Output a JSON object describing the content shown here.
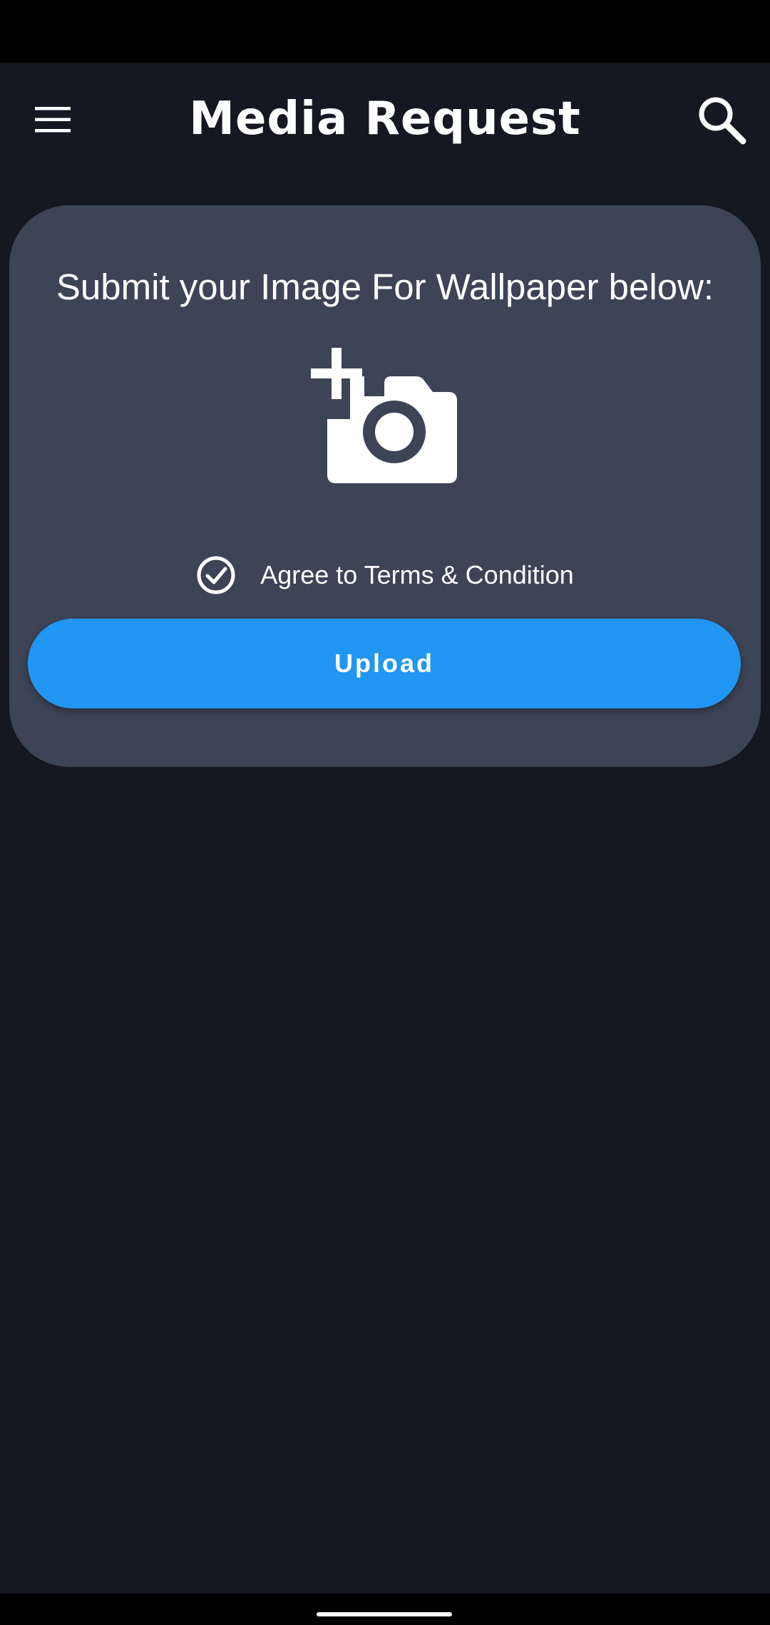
{
  "app_bar": {
    "title": "Media Request",
    "menu_icon": "hamburger-menu-icon",
    "search_icon": "search-icon"
  },
  "card": {
    "heading": "Submit your Image For Wallpaper below:",
    "image_picker_icon": "add-a-photo-icon",
    "terms": {
      "label": "Agree to Terms & Condition",
      "checked": true,
      "icon": "check-circle-icon"
    },
    "upload_label": "Upload"
  },
  "colors": {
    "background": "#151820",
    "card": "#3c4456",
    "accent": "#2196f3",
    "text": "#ffffff"
  }
}
